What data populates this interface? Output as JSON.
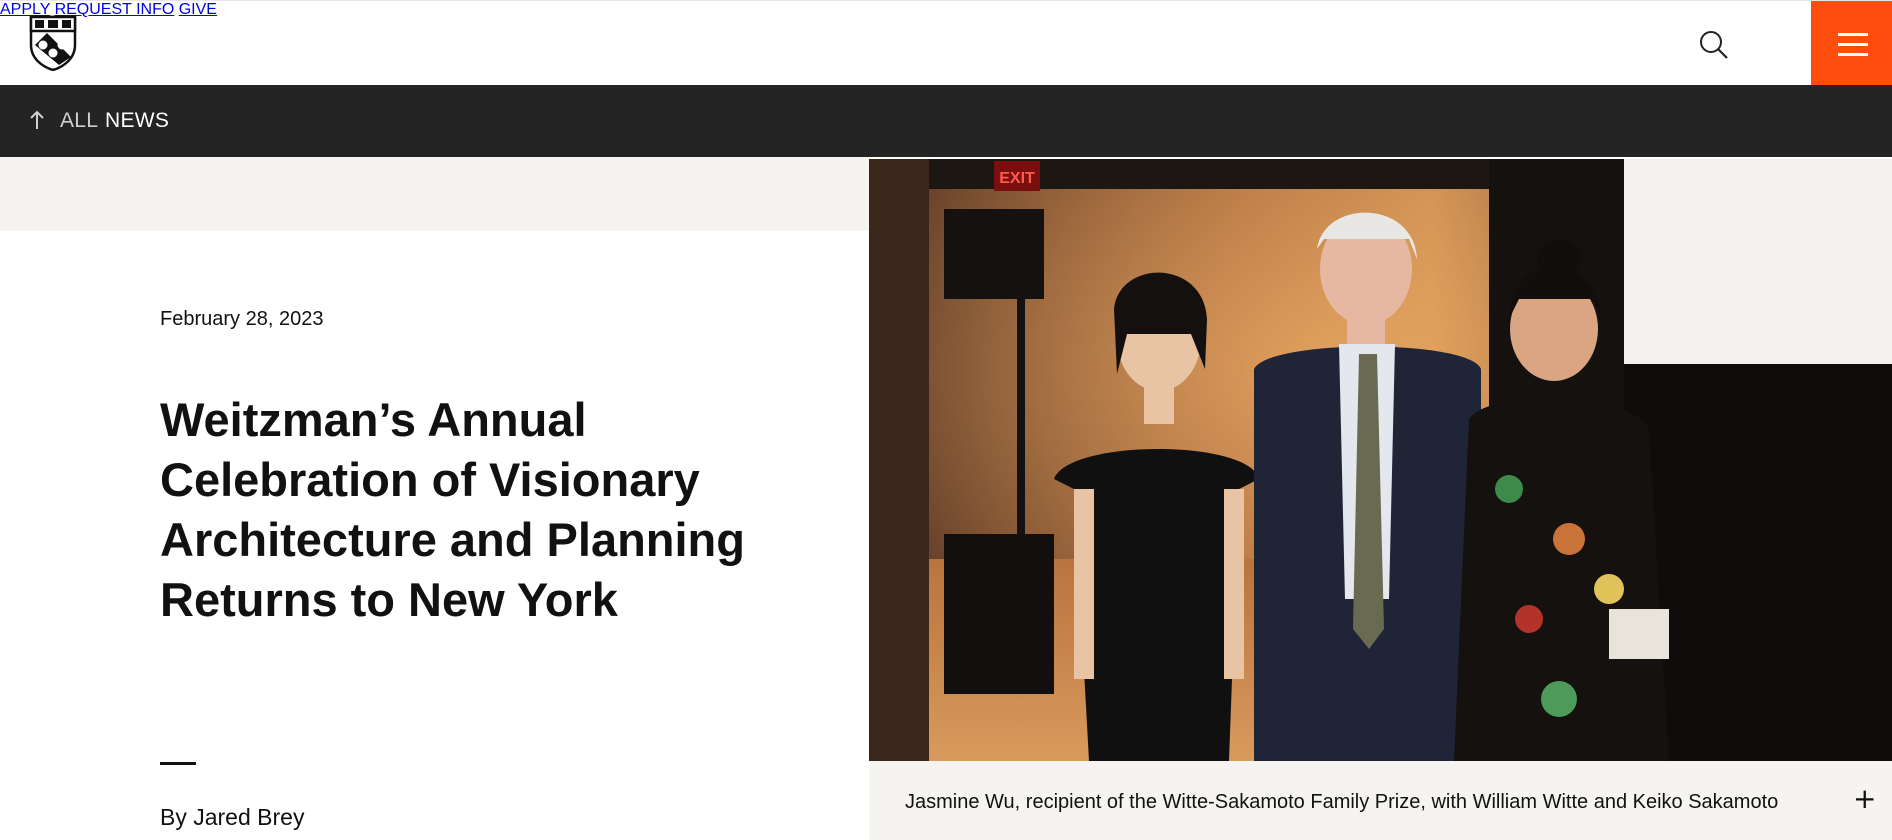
{
  "header": {
    "logo_name": "penn-shield-logo",
    "nav": [
      {
        "label": "APPLY"
      },
      {
        "label": "REQUEST INFO"
      },
      {
        "label": "GIVE"
      }
    ],
    "search_icon": "search-icon",
    "menu_icon": "hamburger-menu-icon",
    "menu_color": "#ff4d0d"
  },
  "subnav": {
    "icon": "arrow-up-icon",
    "prefix": "ALL",
    "label": "NEWS"
  },
  "article": {
    "date": "February 28, 2023",
    "title": "Weitzman’s Annual Celebration of Visionary Architecture and Planning Returns to New York",
    "byline": "By Jared Brey"
  },
  "photo": {
    "exit_sign": "EXIT",
    "caption": "Jasmine Wu, recipient of the Witte-Sakamoto Family Prize, with William Witte and Keiko Sakamoto",
    "expand_icon": "plus-icon",
    "expand_label": "+"
  }
}
